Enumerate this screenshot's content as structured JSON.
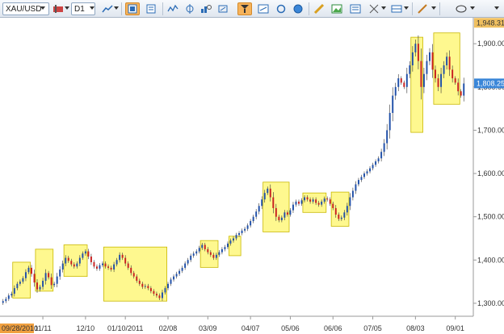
{
  "toolbar": {
    "symbol": "XAU/USD",
    "timeframe": "D1",
    "icons": [
      "line-chart-icon",
      "candles-icon",
      "bars-icon",
      "indicators-icon",
      "crosshair-icon",
      "zoom-icon",
      "magnet-icon",
      "compare-icon",
      "globe-icon",
      "ruler-icon",
      "save-image-icon",
      "template-icon",
      "fibonacci-icon",
      "layout-icon",
      "pen-icon",
      "ellipse-icon"
    ]
  },
  "chart_data": {
    "type": "candlestick",
    "symbol": "XAU/USD",
    "timeframe": "D1",
    "y_ticks": [
      "1,300.00",
      "1,400.00",
      "1,500.00",
      "1,600.00",
      "1,700.00",
      "1,800.00",
      "1,900.00"
    ],
    "ylim": [
      1270,
      1960
    ],
    "current_price": "1,808.25",
    "high_marker": "1,948.31",
    "x_ticks": [
      "09/28/2010",
      "11/11",
      "12/10",
      "01/10/2011",
      "02/08",
      "03/09",
      "04/07",
      "05/06",
      "06/06",
      "07/05",
      "08/03",
      "09/01"
    ],
    "x_start_label": "09/28/2010",
    "closes": [
      1305,
      1310,
      1318,
      1322,
      1335,
      1345,
      1350,
      1358,
      1372,
      1382,
      1368,
      1348,
      1332,
      1338,
      1352,
      1370,
      1360,
      1342,
      1345,
      1362,
      1378,
      1392,
      1405,
      1398,
      1390,
      1385,
      1392,
      1405,
      1415,
      1420,
      1408,
      1395,
      1385,
      1380,
      1388,
      1392,
      1385,
      1382,
      1378,
      1390,
      1400,
      1412,
      1405,
      1392,
      1382,
      1370,
      1362,
      1352,
      1345,
      1338,
      1340,
      1335,
      1328,
      1322,
      1318,
      1312,
      1325,
      1335,
      1345,
      1355,
      1362,
      1368,
      1375,
      1382,
      1392,
      1400,
      1410,
      1415,
      1420,
      1428,
      1435,
      1425,
      1418,
      1412,
      1405,
      1412,
      1418,
      1425,
      1430,
      1438,
      1445,
      1450,
      1458,
      1462,
      1468,
      1472,
      1480,
      1490,
      1500,
      1512,
      1525,
      1540,
      1555,
      1565,
      1545,
      1520,
      1500,
      1492,
      1498,
      1510,
      1505,
      1515,
      1528,
      1535,
      1530,
      1538,
      1545,
      1540,
      1535,
      1540,
      1532,
      1528,
      1535,
      1542,
      1540,
      1530,
      1520,
      1505,
      1495,
      1498,
      1510,
      1525,
      1545,
      1560,
      1575,
      1585,
      1592,
      1600,
      1605,
      1612,
      1620,
      1628,
      1635,
      1650,
      1670,
      1700,
      1740,
      1780,
      1800,
      1820,
      1810,
      1800,
      1830,
      1850,
      1880,
      1900,
      1860,
      1800,
      1830,
      1860,
      1880,
      1840,
      1820,
      1800,
      1830,
      1850,
      1870,
      1840,
      1820,
      1810,
      1790,
      1780,
      1808
    ],
    "highlight_boxes": [
      {
        "from_index": 4,
        "to_index": 9,
        "low": 1312,
        "high": 1395
      },
      {
        "from_index": 12,
        "to_index": 17,
        "low": 1328,
        "high": 1425
      },
      {
        "from_index": 22,
        "to_index": 29,
        "low": 1362,
        "high": 1435
      },
      {
        "from_index": 36,
        "to_index": 57,
        "low": 1305,
        "high": 1430
      },
      {
        "from_index": 70,
        "to_index": 75,
        "low": 1383,
        "high": 1445
      },
      {
        "from_index": 80,
        "to_index": 83,
        "low": 1410,
        "high": 1455
      },
      {
        "from_index": 92,
        "to_index": 100,
        "low": 1465,
        "high": 1580
      },
      {
        "from_index": 106,
        "to_index": 113,
        "low": 1510,
        "high": 1555
      },
      {
        "from_index": 116,
        "to_index": 121,
        "low": 1478,
        "high": 1557
      },
      {
        "from_index": 144,
        "to_index": 147,
        "low": 1695,
        "high": 1915
      },
      {
        "from_index": 152,
        "to_index": 160,
        "low": 1760,
        "high": 1925
      }
    ]
  }
}
